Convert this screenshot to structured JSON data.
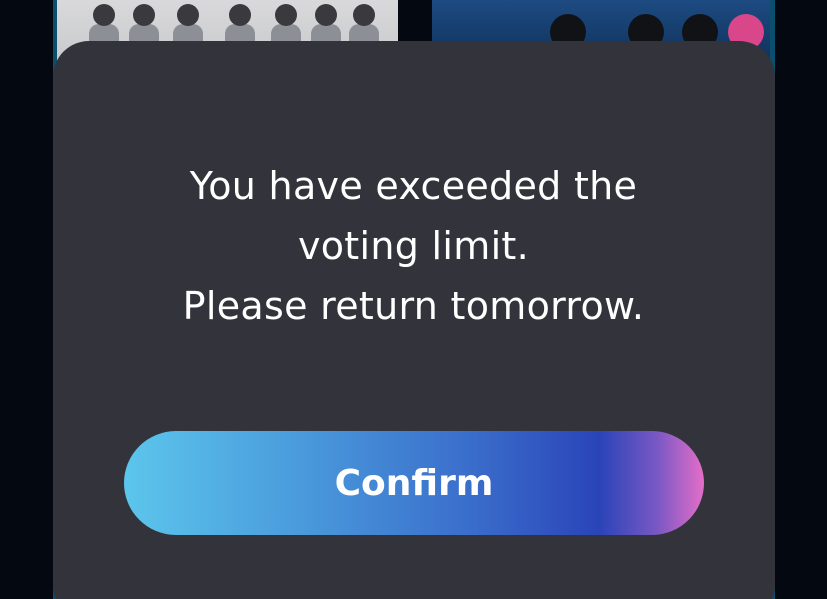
{
  "dialog": {
    "message_lines": [
      "You have exceeded the",
      "voting limit.",
      "Please return tomorrow."
    ],
    "confirm_label": "Confirm"
  },
  "colors": {
    "modal_background": "#33333b",
    "page_background": "#040810",
    "button_gradient_start": "#5cc6ec",
    "button_gradient_mid": "#2a44b8",
    "button_gradient_end": "#e46ec8",
    "text": "#ffffff"
  }
}
